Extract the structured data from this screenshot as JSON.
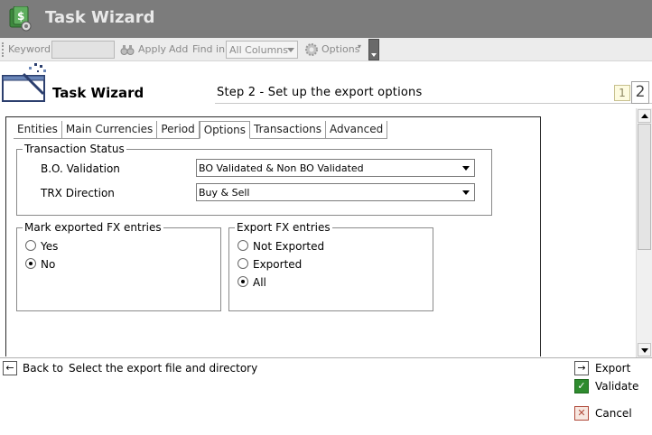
{
  "window": {
    "title": "Task Wizard"
  },
  "toolbar": {
    "keyword_label": "Keyword",
    "keyword_value": "",
    "apply_label": "Apply",
    "add_label": "Add",
    "find_in_label": "Find in",
    "find_in_value": "All Columns",
    "options_label": "Options"
  },
  "wizard": {
    "title": "Task Wizard",
    "step_title": "Step 2 - Set up the export options",
    "steps": [
      "1",
      "2"
    ],
    "current_step": 2
  },
  "tabs": [
    {
      "label": "Entities",
      "active": false
    },
    {
      "label": "Main Currencies",
      "active": false
    },
    {
      "label": "Period",
      "active": false
    },
    {
      "label": "Options",
      "active": true
    },
    {
      "label": "Transactions",
      "active": false
    },
    {
      "label": "Advanced",
      "active": false
    }
  ],
  "transaction_status": {
    "legend": "Transaction Status",
    "bo_validation_label": "B.O. Validation",
    "bo_validation_value": "BO Validated & Non BO Validated",
    "trx_direction_label": "TRX Direction",
    "trx_direction_value": "Buy & Sell"
  },
  "mark_exported": {
    "legend": "Mark exported FX entries",
    "options": [
      {
        "label": "Yes",
        "checked": false
      },
      {
        "label": "No",
        "checked": true
      }
    ]
  },
  "export_fx": {
    "legend": "Export FX entries",
    "options": [
      {
        "label": "Not Exported",
        "checked": false
      },
      {
        "label": "Exported",
        "checked": false
      },
      {
        "label": "All",
        "checked": true
      }
    ]
  },
  "bottom": {
    "back_label": "Back to",
    "back_description": "Select the export file and directory",
    "export_label": "Export",
    "validate_label": "Validate",
    "cancel_label": "Cancel"
  },
  "colors": {
    "titlebar": "#7c7c7c",
    "toolbar": "#ececec",
    "validate": "#2e8b2e",
    "cancel": "#b04a3a"
  }
}
